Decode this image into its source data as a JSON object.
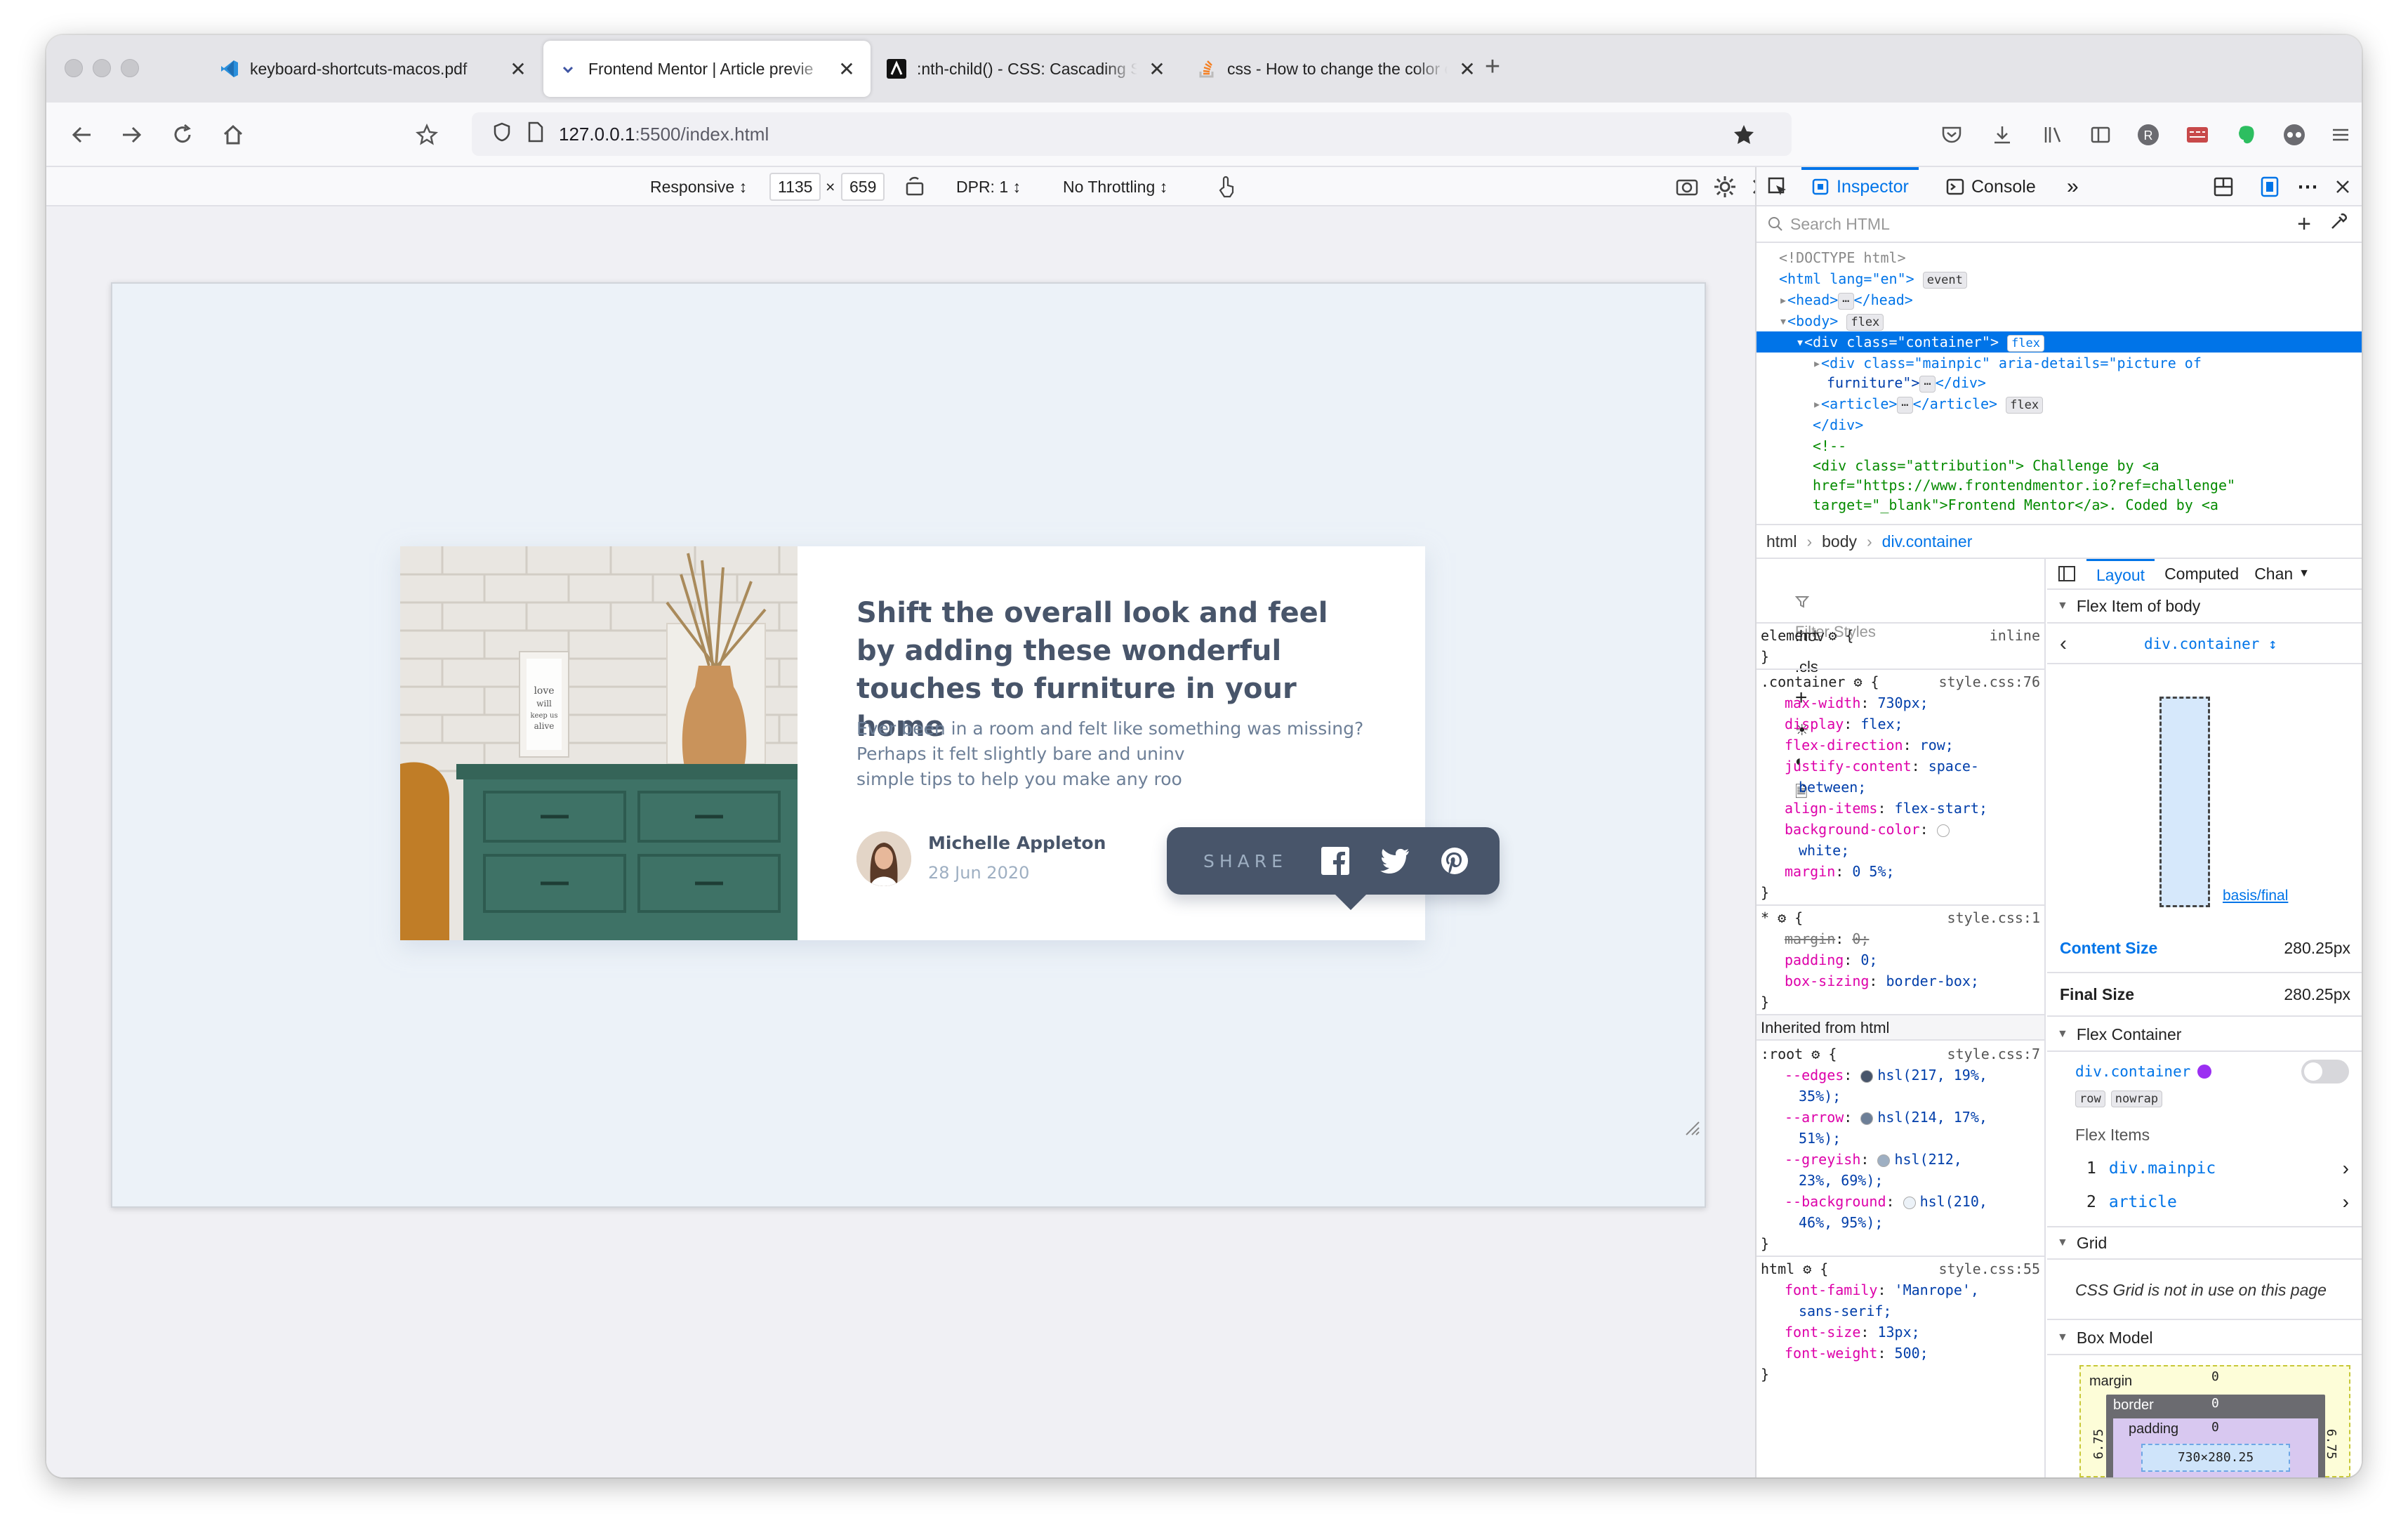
{
  "tabs": [
    {
      "title": "keyboard-shortcuts-macos.pdf",
      "icon": "vscode-icon"
    },
    {
      "title": "Frontend Mentor | Article previe",
      "icon": "frontend-mentor-icon"
    },
    {
      "title": ":nth-child() - CSS: Cascading S",
      "icon": "mdn-icon"
    },
    {
      "title": "css - How to change the color o",
      "icon": "stackoverflow-icon"
    }
  ],
  "url": {
    "host": "127.0.0.1",
    "path": ":5500/index.html"
  },
  "rdm": {
    "mode": "Responsive ↕",
    "width": "1135",
    "times": "×",
    "height": "659",
    "dpr": "DPR: 1 ↕",
    "throttling": "No Throttling ↕"
  },
  "card": {
    "title": "Shift the overall look and feel by adding these wonderful touches to furniture in your home",
    "description_l1": "Ever been in a room and felt like something was missing?",
    "description_l2": "Perhaps it felt slightly bare and uninv",
    "description_l3": "simple tips to help you make any roo",
    "author": "Michelle Appleton",
    "date": "28 Jun 2020",
    "frame_text": "love will keep us alive"
  },
  "share_popup": {
    "label": "SHARE"
  },
  "devtools": {
    "tabs": {
      "inspector": "Inspector",
      "console": "Console"
    },
    "search_placeholder": "Search HTML",
    "markup": {
      "doctype": "<!DOCTYPE html>",
      "html_open": "<html lang=\"en\">",
      "event_badge": "event",
      "head": "<head>",
      "head_close": "</head>",
      "body": "<body>",
      "flex_badge": "flex",
      "container": "<div class=\"container\">",
      "mainpic_1": "<div class=\"mainpic\" aria-details=\"picture of",
      "mainpic_2": "furniture\">",
      "div_close": "</div>",
      "article": "<article>",
      "article_close": "</article>",
      "comment_open": "<!--",
      "attr_1": "<div class=\"attribution\"> Challenge by <a",
      "attr_2": "href=\"https://www.frontendmentor.io?ref=challenge\"",
      "attr_3": "target=\"_blank\">Frontend Mentor</a>. Coded by <a"
    },
    "breadcrumbs": [
      "html",
      "body",
      "div.container"
    ],
    "rules": {
      "filter_placeholder": "Filter Styles",
      "hov": ":hov",
      "cls": ".cls",
      "element_selector": "element",
      "element_src": "inline",
      "container_selector": ".container",
      "container_src": "style.css:76",
      "container_props": [
        {
          "p": "max-width",
          "v": "730px;"
        },
        {
          "p": "display",
          "v": "flex;"
        },
        {
          "p": "flex-direction",
          "v": "row;"
        },
        {
          "p": "justify-content",
          "v": "space-"
        },
        {
          "p": "",
          "v": "between;"
        },
        {
          "p": "align-items",
          "v": "flex-start;"
        },
        {
          "p": "background-color",
          "v": ""
        },
        {
          "p": "",
          "v": "white;"
        },
        {
          "p": "margin",
          "v": "0 5%;"
        }
      ],
      "star_selector": "*",
      "star_src": "style.css:1",
      "star_props": [
        {
          "p": "margin",
          "v": "0;"
        },
        {
          "p": "padding",
          "v": "0;"
        },
        {
          "p": "box-sizing",
          "v": "border-box;"
        }
      ],
      "inherited_label": "Inherited from html",
      "root_selector": ":root",
      "root_src": "style.css:7",
      "root_props": [
        {
          "p": "--edges",
          "v": "hsl(217, 19%,"
        },
        {
          "p": "",
          "v": "35%);"
        },
        {
          "p": "--arrow",
          "v": "hsl(214, 17%,"
        },
        {
          "p": "",
          "v": "51%);"
        },
        {
          "p": "--greyish",
          "v": "hsl(212,"
        },
        {
          "p": "",
          "v": "23%, 69%);"
        },
        {
          "p": "--background",
          "v": "hsl(210,"
        },
        {
          "p": "",
          "v": "46%, 95%);"
        }
      ],
      "html_selector": "html",
      "html_src": "style.css:55",
      "html_props": [
        {
          "p": "font-family",
          "v": "'Manrope',"
        },
        {
          "p": "",
          "v": "sans-serif;"
        },
        {
          "p": "font-size",
          "v": "13px;"
        },
        {
          "p": "font-weight",
          "v": "500;"
        }
      ]
    },
    "layout": {
      "tabs": [
        "Layout",
        "Computed",
        "Chan"
      ],
      "flex_item_heading": "Flex Item of body",
      "selected_node": "div.container ↕",
      "basis_label": "basis/final",
      "content_size_label": "Content Size",
      "content_size": "280.25px",
      "final_size_label": "Final Size",
      "final_size": "280.25px",
      "flex_container_heading": "Flex Container",
      "container_node": "div.container",
      "direction_badge": "row",
      "wrap_badge": "nowrap",
      "flex_items_label": "Flex Items",
      "flex_items": [
        {
          "index": "1",
          "name": "div.mainpic"
        },
        {
          "index": "2",
          "name": "article"
        }
      ],
      "grid_heading": "Grid",
      "grid_note": "CSS Grid is not in use on this page",
      "box_model_heading": "Box Model",
      "box": {
        "margin_label": "margin",
        "border_label": "border",
        "padding_label": "padding",
        "zero": "0",
        "dims": "730×280.25",
        "side_left": "6.75",
        "side_right": "6.75"
      }
    }
  },
  "colors": {
    "accent": "#0074e8",
    "card_heading": "#48556a",
    "card_text": "#6d7f97",
    "popup_bg": "#48556a",
    "swatch_edges": "#48556a",
    "swatch_arrow": "#6d7f97",
    "swatch_greyish": "#9eafc2",
    "swatch_background": "#ecf2f8"
  }
}
